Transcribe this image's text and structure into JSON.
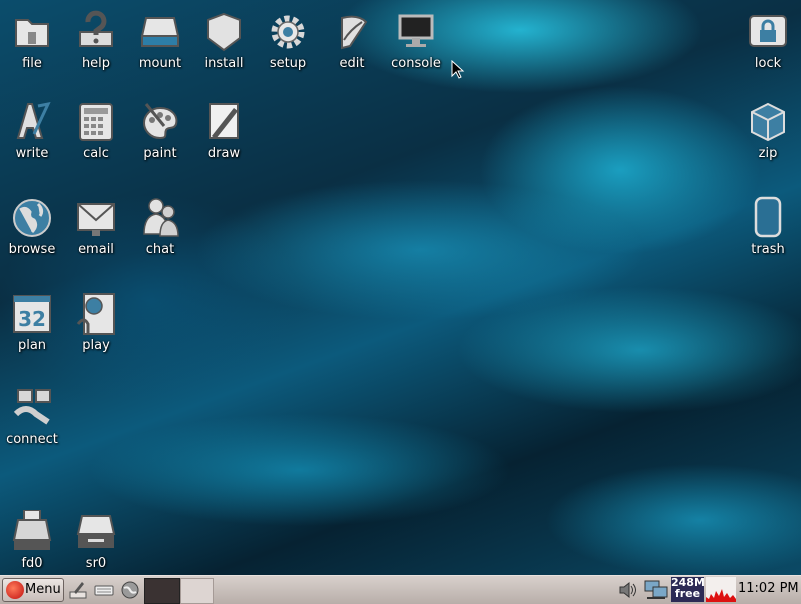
{
  "desktop_icons": {
    "file": "file",
    "help": "help",
    "mount": "mount",
    "install": "install",
    "setup": "setup",
    "edit": "edit",
    "console": "console",
    "lock": "lock",
    "write": "write",
    "calc": "calc",
    "paint": "paint",
    "draw": "draw",
    "zip": "zip",
    "browse": "browse",
    "email": "email",
    "chat": "chat",
    "trash": "trash",
    "plan": "plan",
    "plan_date": "32",
    "play": "play",
    "connect": "connect",
    "fd0": "fd0",
    "sr0": "sr0"
  },
  "taskbar": {
    "menu_label": "Menu",
    "memory_line1": "248M",
    "memory_line2": "free",
    "clock": "11:02 PM"
  }
}
